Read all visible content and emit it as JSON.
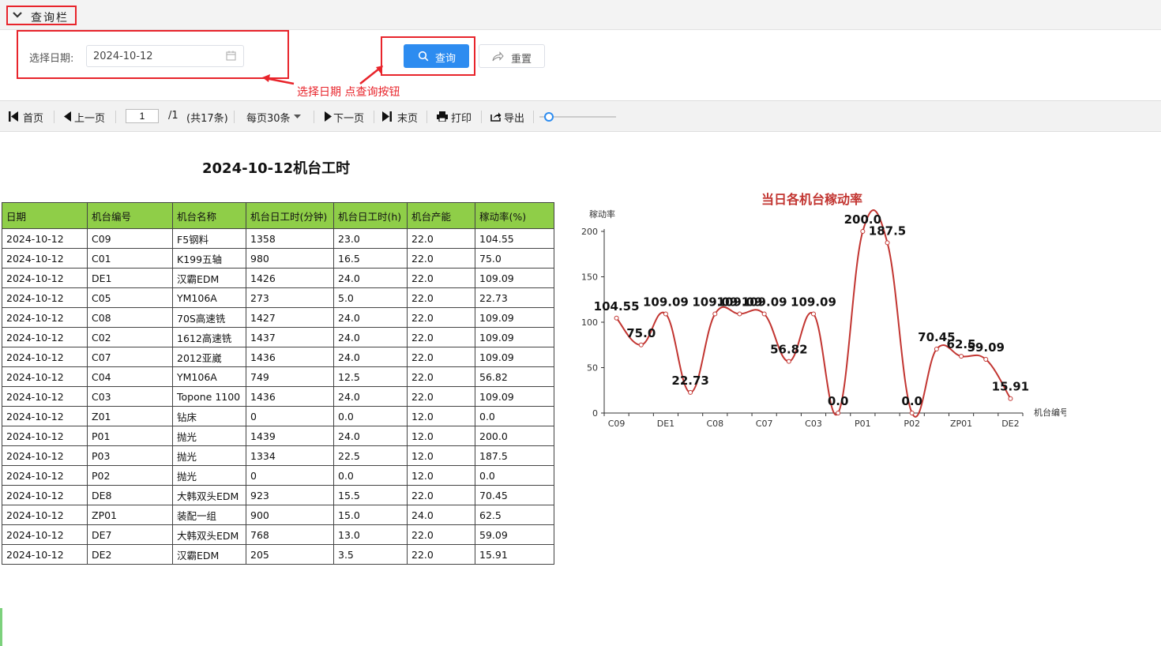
{
  "query_bar": {
    "title": "查询栏",
    "date_label": "选择日期:",
    "date_value": "2024-10-12",
    "query_button": "查询",
    "reset_button": "重置",
    "annotation": "选择日期 点查询按钮"
  },
  "toolbar": {
    "first": "首页",
    "prev": "上一页",
    "page_value": "1",
    "page_total": "/1",
    "record_count": "(共17条)",
    "page_size": "每页30条",
    "next": "下一页",
    "last": "末页",
    "print": "打印",
    "export": "导出"
  },
  "report": {
    "title": "2024-10-12机台工时",
    "columns": [
      "日期",
      "机台编号",
      "机台名称",
      "机台日工时(分钟)",
      "机台日工时(h)",
      "机台产能",
      "稼动率(%)"
    ],
    "rows": [
      [
        "2024-10-12",
        "C09",
        "F5钢料",
        "1358",
        "23.0",
        "22.0",
        "104.55"
      ],
      [
        "2024-10-12",
        "C01",
        "K199五轴",
        "980",
        "16.5",
        "22.0",
        "75.0"
      ],
      [
        "2024-10-12",
        "DE1",
        "汉霸EDM",
        "1426",
        "24.0",
        "22.0",
        "109.09"
      ],
      [
        "2024-10-12",
        "C05",
        "YM106A",
        "273",
        "5.0",
        "22.0",
        "22.73"
      ],
      [
        "2024-10-12",
        "C08",
        "70S高速铣",
        "1427",
        "24.0",
        "22.0",
        "109.09"
      ],
      [
        "2024-10-12",
        "C02",
        "1612高速铣",
        "1437",
        "24.0",
        "22.0",
        "109.09"
      ],
      [
        "2024-10-12",
        "C07",
        "2012亚崴",
        "1436",
        "24.0",
        "22.0",
        "109.09"
      ],
      [
        "2024-10-12",
        "C04",
        "YM106A",
        "749",
        "12.5",
        "22.0",
        "56.82"
      ],
      [
        "2024-10-12",
        "C03",
        "Topone 1100",
        "1436",
        "24.0",
        "22.0",
        "109.09"
      ],
      [
        "2024-10-12",
        "Z01",
        "钻床",
        "0",
        "0.0",
        "12.0",
        "0.0"
      ],
      [
        "2024-10-12",
        "P01",
        "抛光",
        "1439",
        "24.0",
        "12.0",
        "200.0"
      ],
      [
        "2024-10-12",
        "P03",
        "抛光",
        "1334",
        "22.5",
        "12.0",
        "187.5"
      ],
      [
        "2024-10-12",
        "P02",
        "抛光",
        "0",
        "0.0",
        "12.0",
        "0.0"
      ],
      [
        "2024-10-12",
        "DE8",
        "大韩双头EDM",
        "923",
        "15.5",
        "22.0",
        "70.45"
      ],
      [
        "2024-10-12",
        "ZP01",
        "装配一组",
        "900",
        "15.0",
        "24.0",
        "62.5"
      ],
      [
        "2024-10-12",
        "DE7",
        "大韩双头EDM",
        "768",
        "13.0",
        "22.0",
        "59.09"
      ],
      [
        "2024-10-12",
        "DE2",
        "汉霸EDM",
        "205",
        "3.5",
        "22.0",
        "15.91"
      ]
    ]
  },
  "colors": {
    "accent": "#2d8cf0",
    "annotation_red": "#e8242b",
    "table_header": "#8fce48",
    "chart_line": "#c23531",
    "chart_title": "#c23531"
  },
  "chart_data": {
    "type": "line",
    "title": "当日各机台稼动率",
    "xlabel": "机台编号",
    "ylabel": "稼动率",
    "ylim": [
      0,
      200
    ],
    "yticks": [
      0,
      50,
      100,
      150,
      200
    ],
    "smooth": true,
    "grid": false,
    "categories": [
      "C09",
      "C01",
      "DE1",
      "C05",
      "C08",
      "C02",
      "C07",
      "C04",
      "C03",
      "Z01",
      "P01",
      "P03",
      "P02",
      "DE8",
      "ZP01",
      "DE7",
      "DE2"
    ],
    "tick_labels": [
      "C09",
      "DE1",
      "C08",
      "C07",
      "C03",
      "P01",
      "P02",
      "ZP01",
      "DE2"
    ],
    "values": [
      104.55,
      75.0,
      109.09,
      22.73,
      109.09,
      109.09,
      109.09,
      56.82,
      109.09,
      0.0,
      200.0,
      187.5,
      0.0,
      70.45,
      62.5,
      59.09,
      15.91
    ],
    "data_labels": [
      "104.55",
      "75.0",
      "109.09",
      "22.73",
      "109.09",
      "109.09",
      "109.09",
      "56.82",
      "109.09",
      "0.0",
      "200.0",
      "187.5",
      "0.0",
      "70.45",
      "62.5",
      "59.09",
      "15.91"
    ]
  }
}
